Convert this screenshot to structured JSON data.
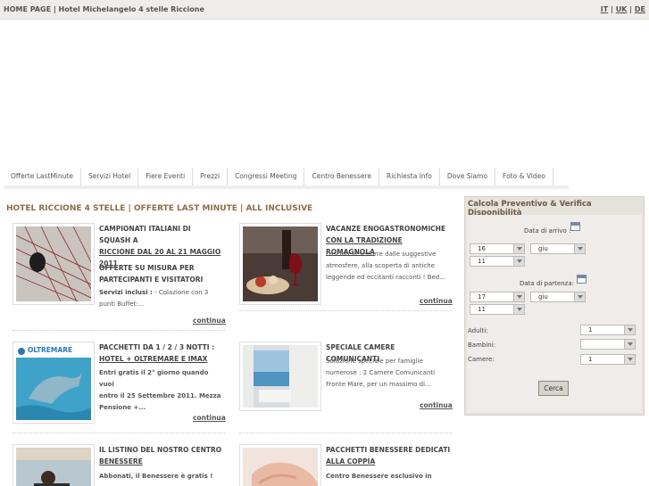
{
  "topbar": {
    "title": "HOME PAGE | Hotel Michelangelo 4 stelle Riccione",
    "langs": [
      "IT",
      "UK",
      "DE"
    ]
  },
  "nav": {
    "items": [
      "Offerte LastMinute",
      "Servizi Hotel",
      "Fiere Eventi",
      "Prezzi",
      "Congressi Meeting",
      "Centro Benessere",
      "Richiesta Info",
      "Dove Siamo",
      "Foto & Video"
    ]
  },
  "main": {
    "title": "HOTEL RICCIONE 4 STELLE | OFFERTE LAST MINUTE | ALL INCLUSIVE"
  },
  "cards": [
    {
      "title_lines": [
        "CAMPIONATI ITALIANI DI SQUASH A",
        "RICCIONE DAL 20 AL 21 MAGGIO",
        "2011"
      ],
      "desc_lines": [
        "OFFERTE SU MISURA PER",
        "PARTECIPANTI E VISITATORI",
        "Servizi inclusi : - Colazione con 3",
        "punti Buffet:..."
      ],
      "more": "continua"
    },
    {
      "title_lines": [
        "VACANZE ENOGASTRONOMICHE",
        "CON LA TRADIZIONE ROMAGNOLA"
      ],
      "desc_lines": [
        "Lasciatevi sedurre dalle suggestive",
        "atmosfere, alla scoperta di antiche",
        "leggende ed eccitanti racconti ! Bed..."
      ],
      "more": "continua"
    },
    {
      "title_lines": [
        "PACCHETTI DA 1 / 2 / 3 NOTTI :",
        "HOTEL + OLTREMARE E IMAX"
      ],
      "desc_lines": [
        "Entri gratis il 2° giorno quando vuoi",
        "entro il 25 Settembre 2011. Mezza",
        "Pensione +..."
      ],
      "more": "continua",
      "thumb_text": "OLTREMARE"
    },
    {
      "title_lines": [
        "SPECIALE CAMERE COMUNICANTI"
      ],
      "desc_lines": [
        "Soluzione speciale per famiglie",
        "numerose : 2 Camere Comunicanti",
        "Fronte Mare, per un massimo di..."
      ],
      "more": "continua"
    },
    {
      "title_lines": [
        "IL LISTINO DEL NOSTRO CENTRO",
        "BENESSERE"
      ],
      "desc_lines": [
        "Abbonati, il Benessere è gratis !"
      ],
      "more": ""
    },
    {
      "title_lines": [
        "PACCHETTI BENESSERE DEDICATI",
        "ALLA COPPIA"
      ],
      "desc_lines": [
        "Centro Benessere esclusivo in"
      ],
      "more": ""
    }
  ],
  "booking": {
    "title": "Calcola Preventivo & Verifica Disponibilità",
    "arrival_label": "Data di arrivo :",
    "arrival_day": "16",
    "arrival_month": "giu",
    "arrival_year": "11",
    "departure_label": "Data di partenza:",
    "departure_day": "17",
    "departure_month": "giu",
    "departure_year": "11",
    "adults_label": "Adulti:",
    "adults_value": "1",
    "children_label": "Bambini:",
    "children_value": "",
    "rooms_label": "Camere:",
    "rooms_value": "1",
    "submit": "Cerca"
  },
  "colors": {
    "accent_title": "#8a6e4a",
    "sidebar_bg": "#e6e2dc",
    "topbar_bg": "#efedea"
  },
  "icons": [
    "calendar-icon",
    "dropdown-arrow-icon"
  ]
}
